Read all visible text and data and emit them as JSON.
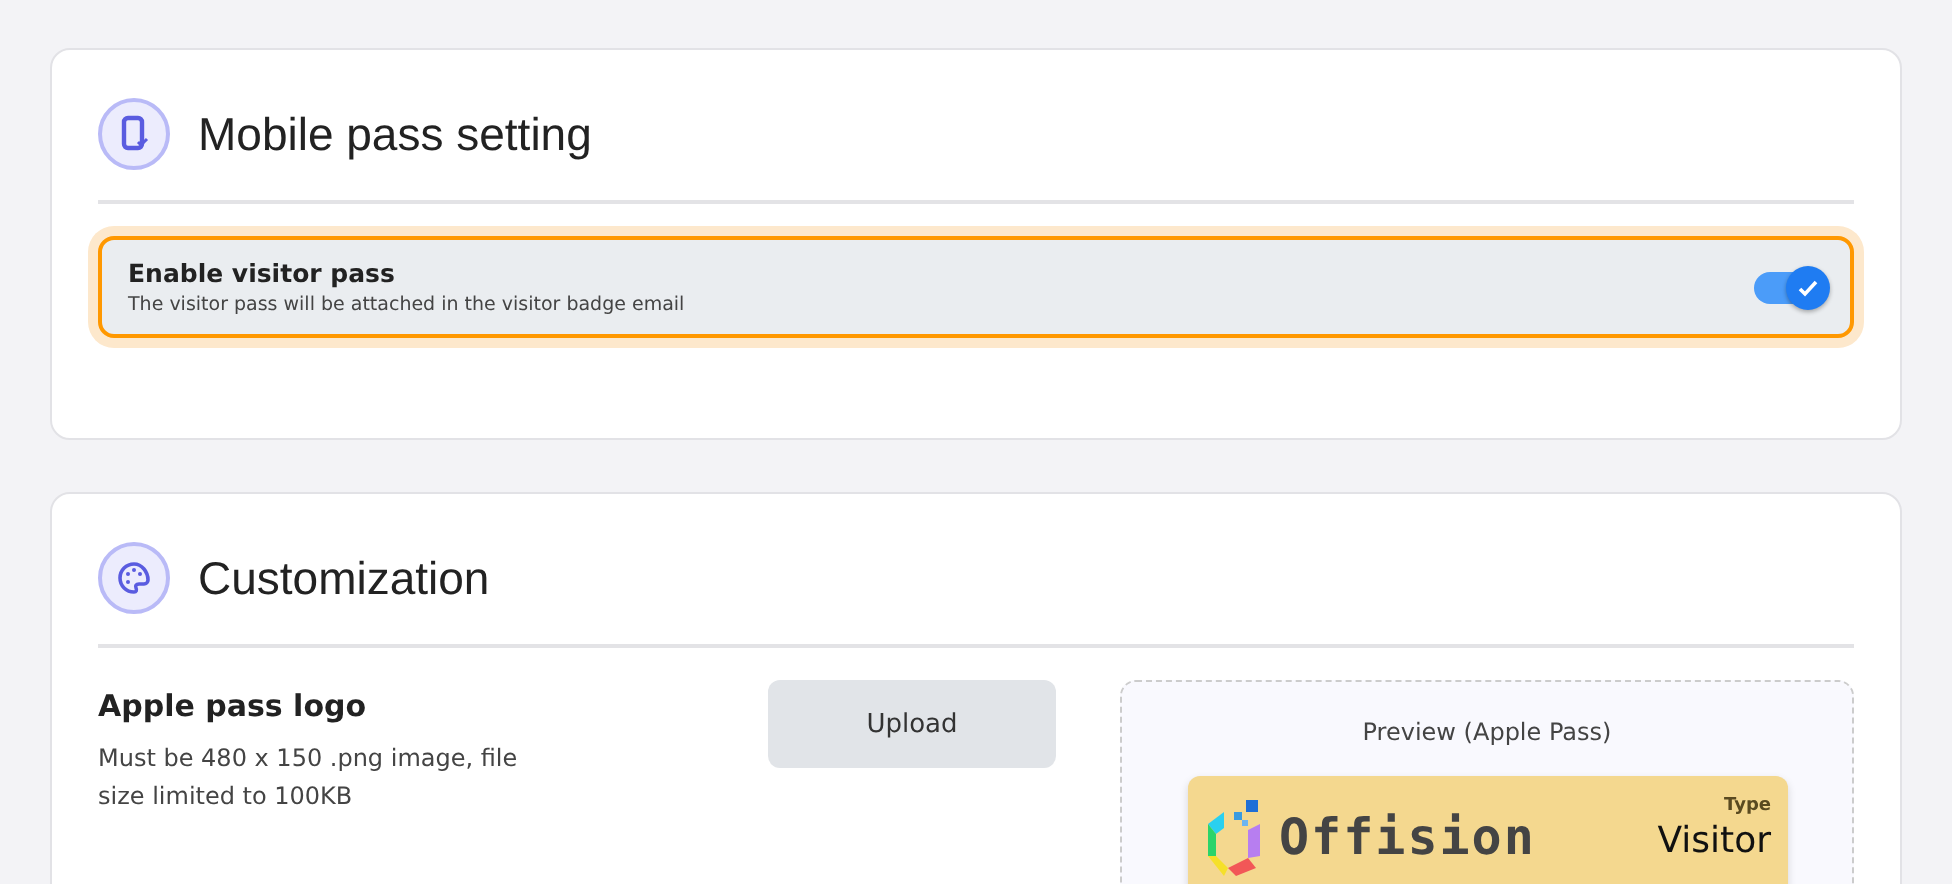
{
  "mobile_pass": {
    "title": "Mobile pass setting",
    "toggle": {
      "label": "Enable visitor pass",
      "description": "The visitor pass will be attached in the visitor badge email",
      "on": true
    }
  },
  "customization": {
    "title": "Customization",
    "logo_setting": {
      "label": "Apple pass logo",
      "description": "Must be 480 x 150 .png image, file size limited to 100KB",
      "button": "Upload"
    },
    "preview": {
      "title": "Preview (Apple Pass)",
      "logo_text": "Offision",
      "type_label": "Type",
      "type_value": "Visitor"
    }
  }
}
